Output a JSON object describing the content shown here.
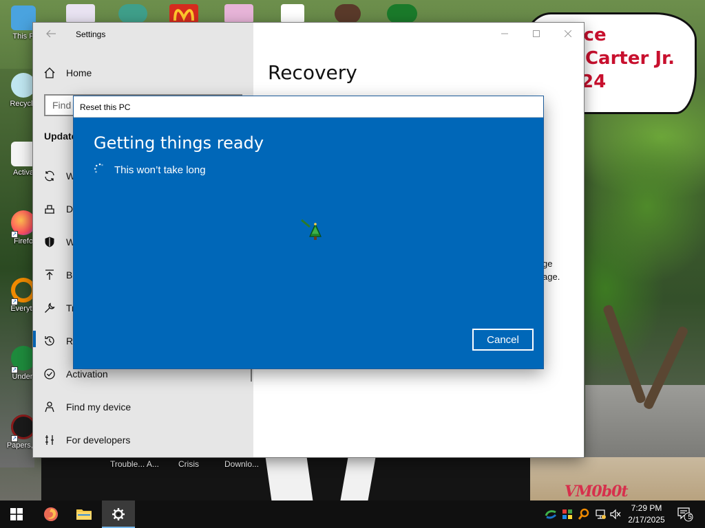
{
  "desktop": {
    "bubble_lines": [
      "ace",
      "l Carter Jr.",
      "24"
    ],
    "icons": [
      {
        "label": "This P"
      },
      {
        "label": "Recycle"
      },
      {
        "label": "Activa"
      },
      {
        "label": "Firefo"
      },
      {
        "label": "Everyth"
      },
      {
        "label": "Undert"
      },
      {
        "label": "Papers, P"
      }
    ],
    "below_labels": [
      "Trouble... A...",
      "Crisis",
      "Downlo..."
    ],
    "watermark": "VM0b0t"
  },
  "settings": {
    "window_title": "Settings",
    "nav": {
      "home": "Home",
      "search_placeholder": "Find",
      "section": "Update",
      "items": [
        {
          "label": "W",
          "icon": "sync-icon"
        },
        {
          "label": "De",
          "icon": "delivery-icon"
        },
        {
          "label": "W",
          "icon": "shield-icon"
        },
        {
          "label": "Ba",
          "icon": "backup-icon"
        },
        {
          "label": "Tr",
          "icon": "wrench-icon"
        },
        {
          "label": "Re",
          "icon": "recovery-icon"
        },
        {
          "label": "Activation",
          "icon": "check-circle-icon"
        },
        {
          "label": "Find my device",
          "icon": "person-location-icon"
        },
        {
          "label": "For developers",
          "icon": "developer-icon"
        }
      ]
    },
    "content": {
      "title": "Recovery",
      "fragments": [
        "ge",
        "age."
      ]
    }
  },
  "reset_dialog": {
    "title": "Reset this PC",
    "heading": "Getting things ready",
    "subtext": "This won’t take long",
    "cancel_label": "Cancel"
  },
  "taskbar": {
    "pinned": [
      {
        "name": "start-button",
        "icon": "windows-icon"
      },
      {
        "name": "firefox-button",
        "icon": "firefox-icon"
      },
      {
        "name": "file-explorer-button",
        "icon": "folder-icon"
      },
      {
        "name": "settings-button",
        "icon": "gear-icon",
        "active": true
      }
    ],
    "clock_time": "7:29 PM",
    "clock_date": "2/17/2025",
    "notification_count": "5"
  }
}
